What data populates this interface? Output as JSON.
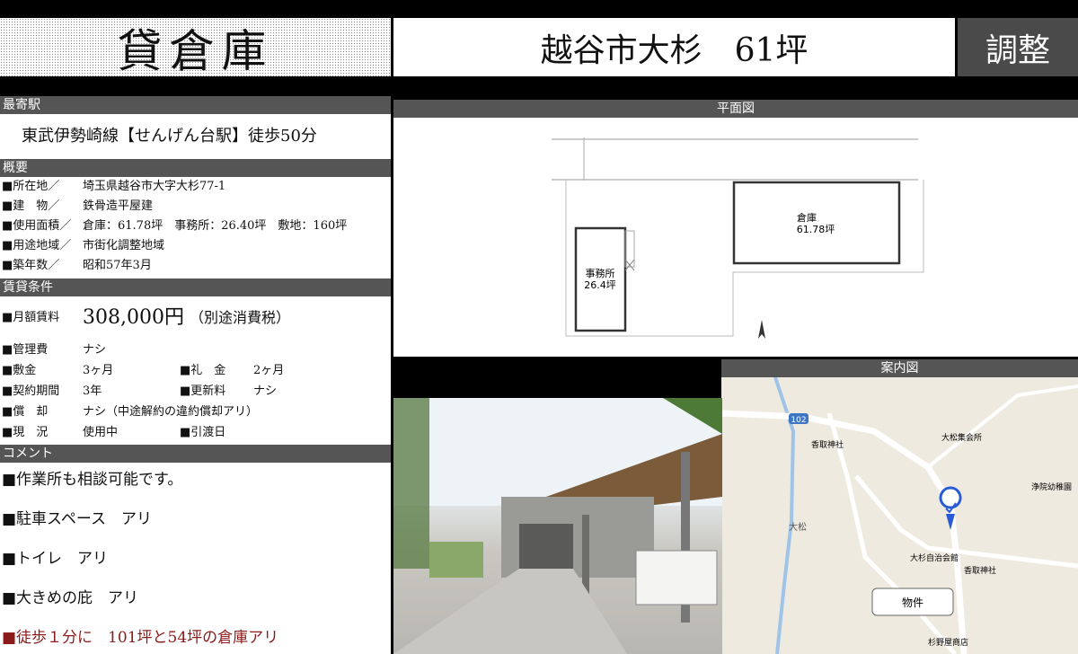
{
  "header": {
    "type": "貸倉庫",
    "title": "越谷市大杉　61坪",
    "status": "調整"
  },
  "station": {
    "label": "最寄駅",
    "text": "東武伊勢崎線【せんげん台駅】徒歩50分"
  },
  "overview": {
    "label": "概要",
    "rows": [
      {
        "key": "■所在地／",
        "value": "埼玉県越谷市大字大杉77-1"
      },
      {
        "key": "■建　物／",
        "value": "鉄骨造平屋建"
      },
      {
        "key": "■使用面積／",
        "value": "倉庫：61.78坪　事務所：26.40坪　敷地：160坪"
      },
      {
        "key": "■用途地域／",
        "value": "市街化調整地域"
      },
      {
        "key": "■築年数／",
        "value": "昭和57年3月"
      }
    ]
  },
  "terms": {
    "label": "賃貸条件",
    "rent_key": "■月額賃料",
    "rent_value": "308,000円",
    "rent_tax": "（別途消費税）",
    "mgmt_key": "■管理費",
    "mgmt_value": "ナシ",
    "deposit_key": "■敷金",
    "deposit_value": "3ヶ月",
    "keymoney_key": "■礼　金",
    "keymoney_value": "2ヶ月",
    "period_key": "■契約期間",
    "period_value": "3年",
    "renewal_key": "■更新料",
    "renewal_value": "ナシ",
    "amort_key": "■償　却",
    "amort_value": "ナシ（中途解約の違約償却アリ）",
    "status_key": "■現　況",
    "status_value": "使用中",
    "handover_key": "■引渡日",
    "handover_value": ""
  },
  "comments": {
    "label": "コメント",
    "items": [
      "■作業所も相談可能です。",
      "■駐車スペース　アリ",
      "■トイレ　アリ",
      "■大きめの庇　アリ"
    ],
    "highlight": "■徒歩１分に　101坪と54坪の倉庫アリ"
  },
  "floorplan": {
    "label": "平面図",
    "warehouse": "倉庫",
    "warehouse_area": "61.78坪",
    "office": "事務所",
    "office_area": "26.4坪"
  },
  "map": {
    "label": "案内図",
    "marker_label": "物件",
    "places": [
      "香取神社",
      "大松集会所",
      "大松",
      "香取神社",
      "大杉自治会館",
      "杉野屋商店",
      "浄院幼稚園"
    ],
    "route_number": "102"
  },
  "colors": {
    "section_bg": "#555555",
    "status_bg": "#4a4a4a",
    "highlight_text": "#8b1a1a",
    "map_pin": "#2a5bd7"
  }
}
